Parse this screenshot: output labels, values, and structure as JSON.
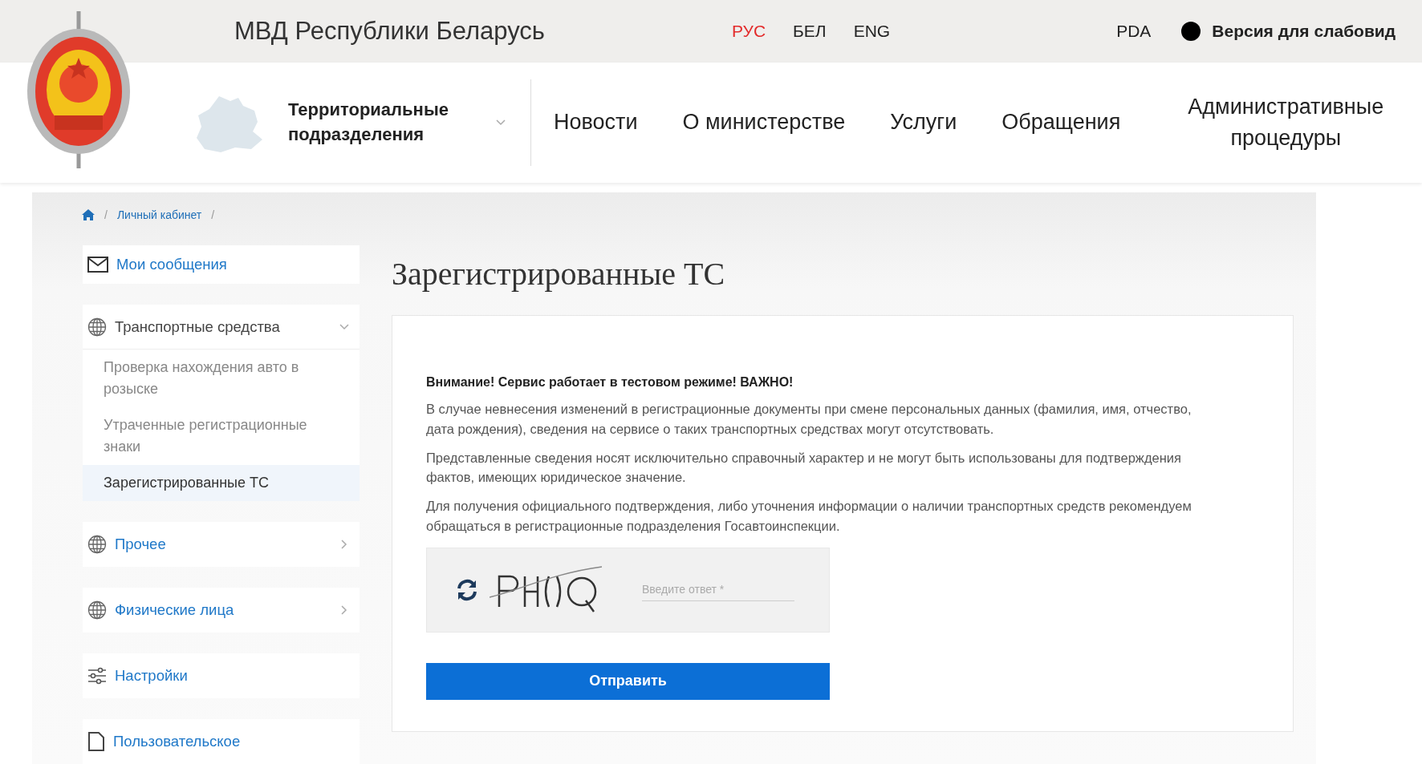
{
  "top_bar": {
    "title": "МВД Республики Беларусь",
    "languages": [
      {
        "label": "РУС",
        "selected": true
      },
      {
        "label": "БЕЛ",
        "selected": false
      },
      {
        "label": "ENG",
        "selected": false
      }
    ],
    "pda": "PDA",
    "low_vision": "Версия для слабовид"
  },
  "nav": {
    "region_selector": "Территориальные подразделения",
    "items": [
      "Новости",
      "О министерстве",
      "Услуги",
      "Обращения",
      "Административные процедуры"
    ]
  },
  "breadcrumb": {
    "separator": "/",
    "items": [
      "Личный кабинет"
    ]
  },
  "sidebar": [
    {
      "kind": "link",
      "label": "Мои сообщения"
    },
    {
      "kind": "section",
      "label": "Транспортные средства",
      "expanded": true,
      "children": [
        {
          "label": "Проверка нахождения авто в розыске",
          "selected": false
        },
        {
          "label": "Утраченные регистрационные знаки",
          "selected": false
        },
        {
          "label": "Зарегистрированные ТС",
          "selected": true
        }
      ]
    },
    {
      "kind": "section",
      "label": "Прочее",
      "expanded": false
    },
    {
      "kind": "section",
      "label": "Физические лица",
      "expanded": false
    },
    {
      "kind": "link",
      "label": "Настройки"
    },
    {
      "kind": "link",
      "label": "Пользовательское"
    }
  ],
  "page_title": "Зарегистрированные ТС",
  "notice": {
    "heading": "Внимание! Сервис работает в тестовом режиме! ВАЖНО!",
    "paragraphs": [
      "В случае невнесения изменений в регистрационные документы при смене персональных данных (фамилия, имя, отчество, дата рождения), сведения на сервисе о таких транспортных средствах могут отсутствовать.",
      "Представленные сведения носят исключительно справочный характер и не могут быть использованы для подтверждения фактов, имеющих юридическое значение.",
      "Для получения официального подтверждения, либо уточнения информации о наличии транспортных средств рекомендуем обращаться в регистрационные подразделения Госавтоинспекции."
    ]
  },
  "captcha": {
    "placeholder": "Введите ответ *"
  },
  "submit": "Отправить"
}
